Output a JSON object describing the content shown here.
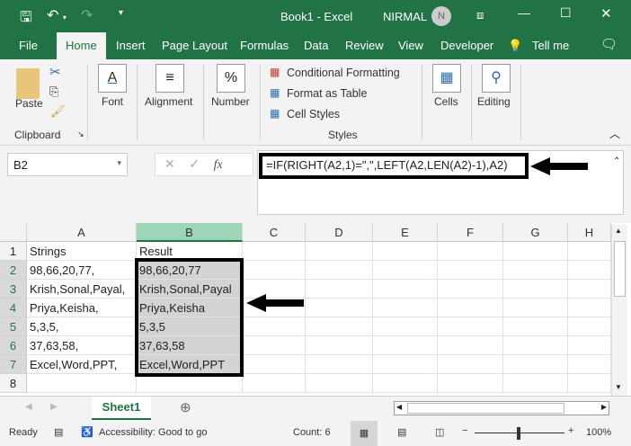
{
  "title": {
    "doc": "Book1  -  Excel",
    "user": "NIRMAL",
    "avatar": "N"
  },
  "tabs": [
    "File",
    "Home",
    "Insert",
    "Page Layout",
    "Formulas",
    "Data",
    "Review",
    "View",
    "Developer",
    "Tell me"
  ],
  "ribbon": {
    "paste": "Paste",
    "clipboard": "Clipboard",
    "font": "Font",
    "alignment": "Alignment",
    "number": "Number",
    "cond": "Conditional Formatting",
    "fmt_table": "Format as Table",
    "cell_styles": "Cell Styles",
    "styles": "Styles",
    "cells": "Cells",
    "editing": "Editing"
  },
  "formula": {
    "name_box": "B2",
    "fx": "fx",
    "value": "=IF(RIGHT(A2,1)=\",\",LEFT(A2,LEN(A2)-1),A2)"
  },
  "columns": [
    "A",
    "B",
    "C",
    "D",
    "E",
    "F",
    "G",
    "H"
  ],
  "rows": [
    "1",
    "2",
    "3",
    "4",
    "5",
    "6",
    "7",
    "8"
  ],
  "cells": {
    "A": [
      "Strings",
      "98,66,20,77,",
      "Krish,Sonal,Payal,",
      "Priya,Keisha,",
      "5,3,5,",
      "37,63,58,",
      "Excel,Word,PPT,",
      ""
    ],
    "B": [
      "Result",
      "98,66,20,77",
      "Krish,Sonal,Payal",
      "Priya,Keisha",
      "5,3,5",
      "37,63,58",
      "Excel,Word,PPT",
      ""
    ]
  },
  "sheet": "Sheet1",
  "status": {
    "ready": "Ready",
    "access": "Accessibility: Good to go",
    "count": "Count: 6",
    "zoom": "100%"
  }
}
